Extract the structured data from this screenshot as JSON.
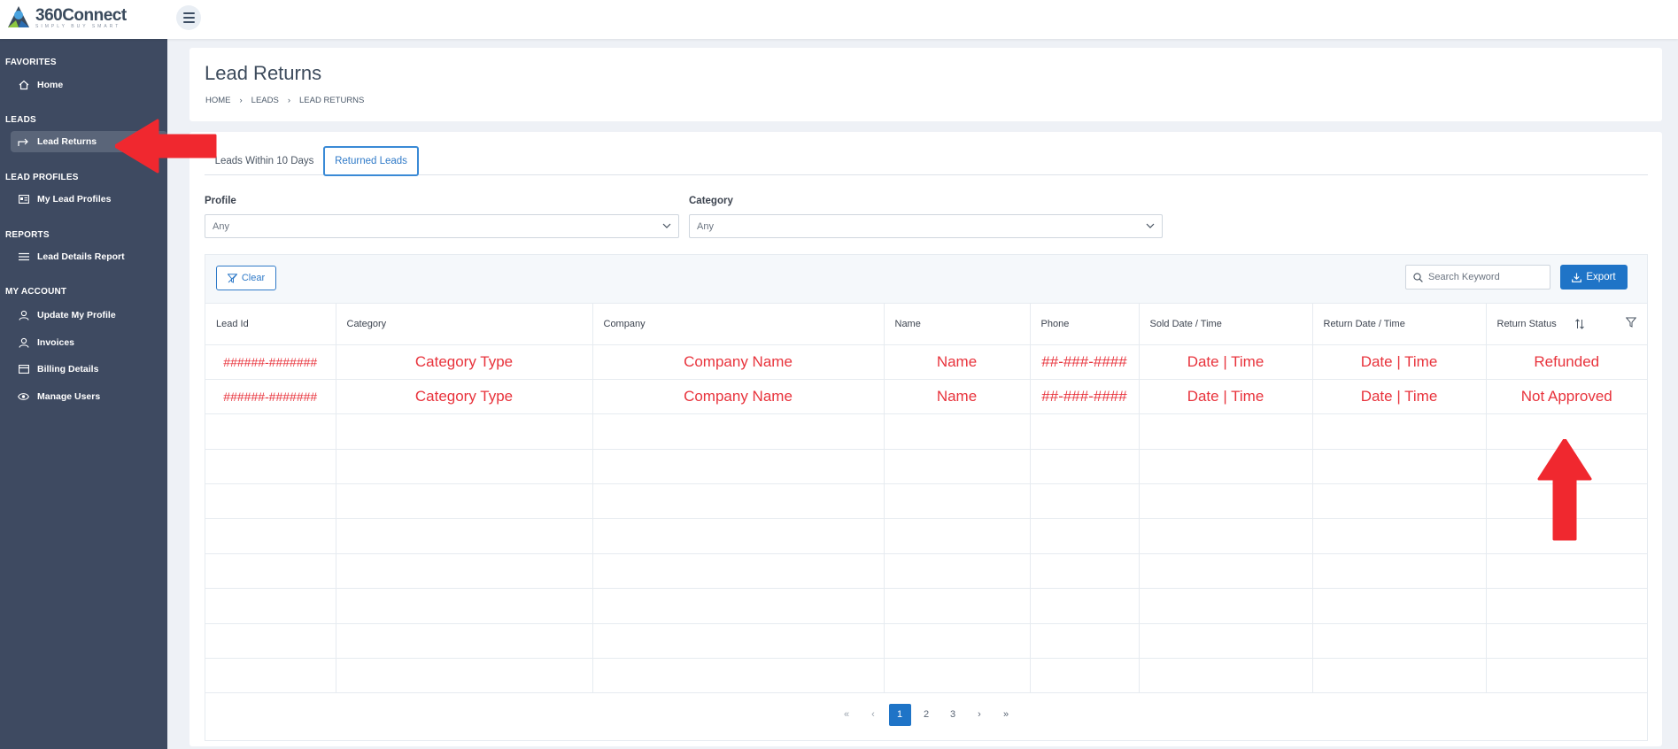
{
  "app": {
    "logo_name": "360Connect",
    "logo_tagline": "SIMPLY BUY SMART"
  },
  "sidebar": {
    "sections": [
      {
        "label": "FAVORITES",
        "items": [
          {
            "label": "Home",
            "icon": "home-icon"
          }
        ]
      },
      {
        "label": "LEADS",
        "items": [
          {
            "label": "Lead Returns",
            "icon": "share-arrow-icon",
            "active": true
          }
        ]
      },
      {
        "label": "LEAD PROFILES",
        "items": [
          {
            "label": "My Lead Profiles",
            "icon": "id-card-icon"
          }
        ]
      },
      {
        "label": "REPORTS",
        "items": [
          {
            "label": "Lead Details Report",
            "icon": "list-icon"
          }
        ]
      },
      {
        "label": "MY ACCOUNT",
        "items": [
          {
            "label": "Update My Profile",
            "icon": "user-icon"
          },
          {
            "label": "Invoices",
            "icon": "user-icon"
          },
          {
            "label": "Billing Details",
            "icon": "credit-card-icon"
          },
          {
            "label": "Manage Users",
            "icon": "eye-icon"
          }
        ]
      }
    ]
  },
  "header": {
    "title": "Lead Returns",
    "breadcrumb": [
      "HOME",
      "LEADS",
      "LEAD RETURNS"
    ]
  },
  "tabs": [
    {
      "label": "Leads Within 10 Days",
      "active": false
    },
    {
      "label": "Returned Leads",
      "active": true
    }
  ],
  "filters": {
    "profile_label": "Profile",
    "profile_value": "Any",
    "category_label": "Category",
    "category_value": "Any"
  },
  "toolbar": {
    "clear_label": "Clear",
    "search_placeholder": "Search Keyword",
    "export_label": "Export"
  },
  "table": {
    "columns": [
      "Lead Id",
      "Category",
      "Company",
      "Name",
      "Phone",
      "Sold Date / Time",
      "Return Date / Time",
      "Return Status"
    ],
    "rows": [
      [
        "######-#######",
        "Category Type",
        "Company Name",
        "Name",
        "##-###-####",
        "Date | Time",
        "Date | Time",
        "Refunded"
      ],
      [
        "######-#######",
        "Category Type",
        "Company Name",
        "Name",
        "##-###-####",
        "Date | Time",
        "Date | Time",
        "Not Approved"
      ]
    ],
    "empty_rows": 8
  },
  "pagination": {
    "pages": [
      "1",
      "2",
      "3"
    ],
    "current": "1",
    "first": "«",
    "prev": "‹",
    "next": "›",
    "last": "»"
  },
  "colors": {
    "sidebar_bg": "#3e4a61",
    "accent": "#1f74c7",
    "annotation_red": "#f0282f"
  }
}
